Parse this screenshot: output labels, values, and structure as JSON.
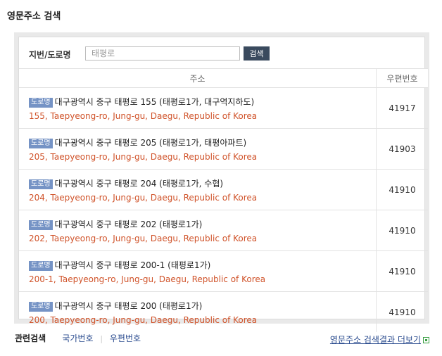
{
  "page_title": "영문주소 검색",
  "search": {
    "label": "지번/도로명",
    "placeholder": "태평로",
    "button_label": "검색"
  },
  "table": {
    "headers": {
      "address": "주소",
      "zipcode": "우편번호"
    },
    "rows": [
      {
        "badge": "도로명",
        "korean": "대구광역시 중구 태평로 155 (태평로1가, 대구역지하도)",
        "english": "155, Taepyeong-ro, Jung-gu, Daegu, Republic of Korea",
        "zip": "41917"
      },
      {
        "badge": "도로명",
        "korean": "대구광역시 중구 태평로 205 (태평로1가, 태평아파트)",
        "english": "205, Taepyeong-ro, Jung-gu, Daegu, Republic of Korea",
        "zip": "41903"
      },
      {
        "badge": "도로명",
        "korean": "대구광역시 중구 태평로 204 (태평로1가, 수협)",
        "english": "204, Taepyeong-ro, Jung-gu, Daegu, Republic of Korea",
        "zip": "41910"
      },
      {
        "badge": "도로명",
        "korean": "대구광역시 중구 태평로 202 (태평로1가)",
        "english": "202, Taepyeong-ro, Jung-gu, Daegu, Republic of Korea",
        "zip": "41910"
      },
      {
        "badge": "도로명",
        "korean": "대구광역시 중구 태평로 200-1 (태평로1가)",
        "english": "200-1, Taepyeong-ro, Jung-gu, Daegu, Republic of Korea",
        "zip": "41910"
      },
      {
        "badge": "도로명",
        "korean": "대구광역시 중구 태평로 200 (태평로1가)",
        "english": "200, Taepyeong-ro, Jung-gu, Daegu, Republic of Korea",
        "zip": "41910"
      }
    ]
  },
  "footer": {
    "related_label": "관련검색",
    "links": [
      "국가번호",
      "우편번호"
    ],
    "more_link": "영문주소 검색결과 더보기"
  },
  "colors": {
    "badge": "#7593c5",
    "english_text": "#d0532a",
    "button": "#3a4a5e",
    "link": "#2b4c8f"
  },
  "icons": {
    "more": "external-window-icon"
  }
}
